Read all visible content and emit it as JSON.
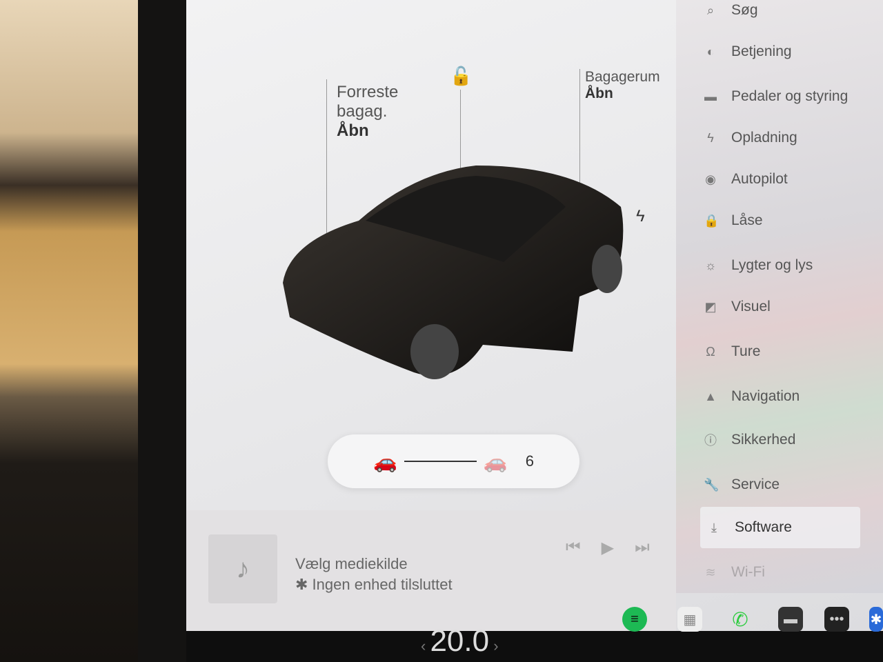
{
  "car_panel": {
    "frunk": {
      "line1": "Forreste",
      "line2": "bagag.",
      "action": "Åbn"
    },
    "trunk": {
      "line1": "Bagagerum",
      "action": "Åbn"
    },
    "lock_icon": "unlock-icon",
    "charge_icon": "lightning-icon",
    "follow_distance": {
      "value": "6",
      "icons": [
        "car-icon",
        "car-icon"
      ]
    }
  },
  "media": {
    "title": "Vælg mediekilde",
    "subtitle": "Ingen enhed tilsluttet",
    "icons": [
      "music-note-icon",
      "bluetooth-icon",
      "previous-icon",
      "play-icon",
      "next-icon"
    ]
  },
  "sidebar": {
    "items": [
      {
        "label": "Søg",
        "icon": "search-icon"
      },
      {
        "label": "Betjening",
        "icon": "toggle-icon"
      },
      {
        "label": "Pedaler og styring",
        "icon": "car-icon"
      },
      {
        "label": "Opladning",
        "icon": "lightning-icon"
      },
      {
        "label": "Autopilot",
        "icon": "steering-wheel-icon"
      },
      {
        "label": "Låse",
        "icon": "lock-icon"
      },
      {
        "label": "Lygter og lys",
        "icon": "light-icon"
      },
      {
        "label": "Visuel",
        "icon": "display-icon"
      },
      {
        "label": "Ture",
        "icon": "trips-icon"
      },
      {
        "label": "Navigation",
        "icon": "navigation-icon"
      },
      {
        "label": "Sikkerhed",
        "icon": "info-circle-icon"
      },
      {
        "label": "Service",
        "icon": "wrench-icon"
      },
      {
        "label": "Software",
        "icon": "download-icon",
        "active": true
      },
      {
        "label": "Wi-Fi",
        "icon": "wifi-icon"
      }
    ]
  },
  "taskbar": {
    "temperature": "20.0",
    "spotify_color": "#1db954",
    "phone_color": "#2ecc40"
  }
}
